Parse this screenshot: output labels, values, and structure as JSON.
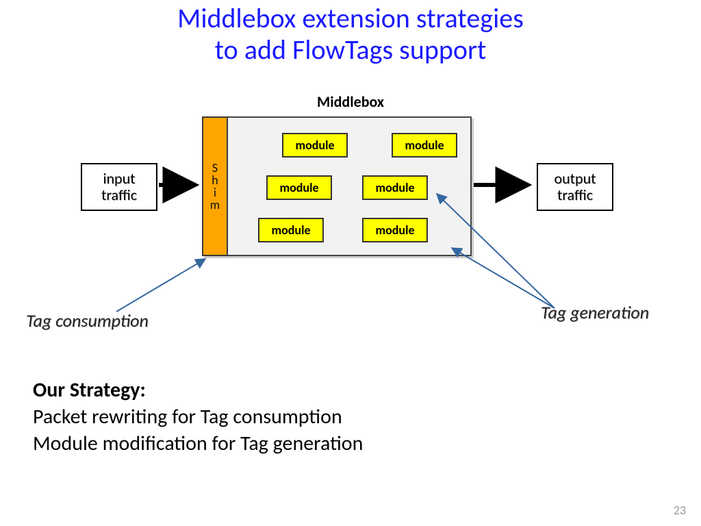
{
  "title_line1": "Middlebox extension strategies",
  "title_line2": "to add FlowTags support",
  "diagram_label": "Middlebox",
  "input_box": "input\ntraffic",
  "output_box": "output\ntraffic",
  "shim_label": "Shim",
  "modules": [
    "module",
    "module",
    "module",
    "module",
    "module",
    "module"
  ],
  "annotations": {
    "tag_consumption": "Tag consumption",
    "tag_generation": "Tag generation"
  },
  "strategy": {
    "heading": "Our Strategy:",
    "line1": "Packet rewriting for Tag consumption",
    "line2": "Module modification for Tag generation"
  },
  "page_number": "23"
}
